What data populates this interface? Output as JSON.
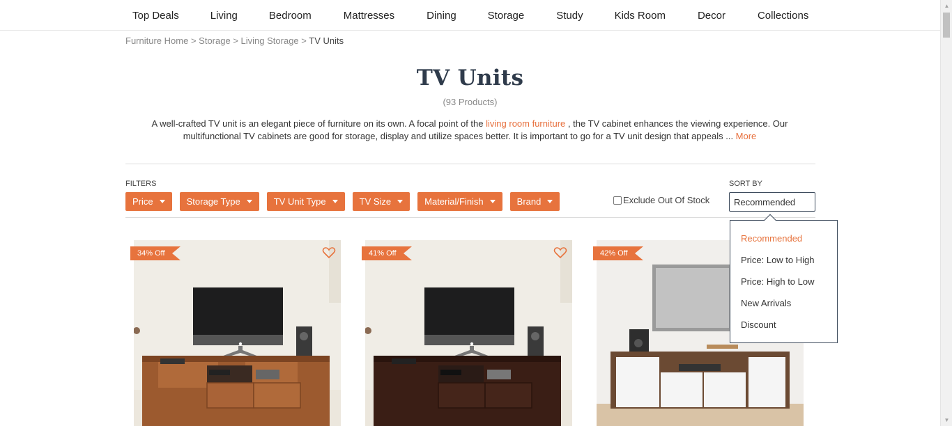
{
  "nav": {
    "items": [
      "Top Deals",
      "Living",
      "Bedroom",
      "Mattresses",
      "Dining",
      "Storage",
      "Study",
      "Kids Room",
      "Decor",
      "Collections"
    ]
  },
  "breadcrumb": {
    "items": [
      "Furniture Home",
      "Storage",
      "Living Storage"
    ],
    "current": "TV Units",
    "separator": ">"
  },
  "page": {
    "title": "TV Units",
    "count": "(93 Products)",
    "desc_part1": "A well-crafted TV unit is an elegant piece of furniture on its own. A focal point of the ",
    "desc_link": "living room furniture ",
    "desc_part2": ", the TV cabinet enhances the viewing experience. Our multifunctional TV cabinets are good for storage, display and utilize spaces better. It is important to go for a TV unit design that appeals ... ",
    "more_label": "More"
  },
  "filters": {
    "label": "FILTERS",
    "buttons": [
      "Price",
      "Storage Type",
      "TV Unit Type",
      "TV Size",
      "Material/Finish",
      "Brand"
    ],
    "exclude_label": "Exclude Out Of Stock",
    "exclude_checked": false
  },
  "sort": {
    "label": "SORT BY",
    "selected": "Recommended",
    "options": [
      "Recommended",
      "Price: Low to High",
      "Price: High to Low",
      "New Arrivals",
      "Discount"
    ]
  },
  "products": [
    {
      "badge": "34% Off",
      "finish": "honey"
    },
    {
      "badge": "41% Off",
      "finish": "walnut"
    },
    {
      "badge": "42% Off",
      "finish": "white"
    }
  ],
  "colors": {
    "accent": "#e7733d",
    "title": "#2f3b4b",
    "border": "#3d4b5c"
  }
}
